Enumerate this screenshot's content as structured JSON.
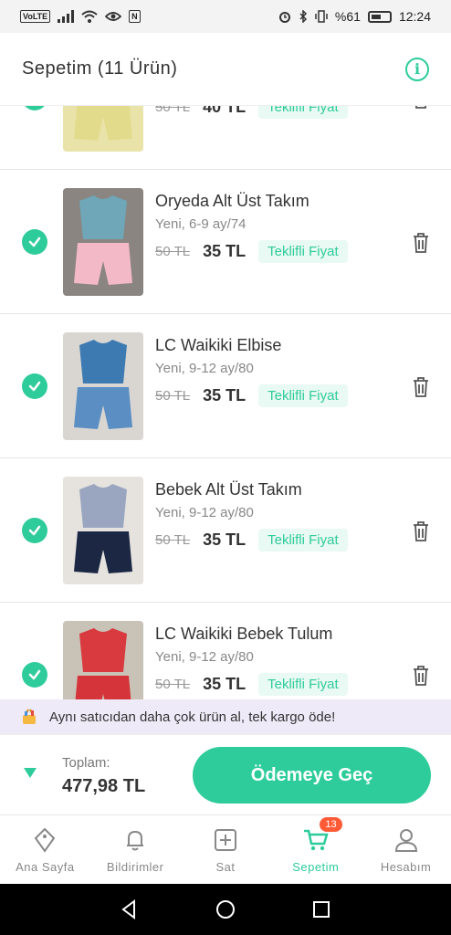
{
  "status_bar": {
    "left_badge": "VoLTE",
    "nfc": "N",
    "battery_pct": "%61",
    "time": "12:24"
  },
  "header": {
    "title": "Sepetim (11 Ürün)",
    "info_icon": "info-icon"
  },
  "items": [
    {
      "title": "",
      "meta": "",
      "old_price": "50 TL",
      "new_price": "40 TL",
      "offer": "Teklifli Fiyat",
      "colors": {
        "bg": "#e9e3a9",
        "top": "#e8e29c",
        "bottom": "#e3db8c"
      }
    },
    {
      "title": "Oryeda Alt Üst Takım",
      "meta": "Yeni, 6-9 ay/74",
      "old_price": "50 TL",
      "new_price": "35 TL",
      "offer": "Teklifli Fiyat",
      "colors": {
        "bg": "#8a8580",
        "top": "#6fa7b8",
        "bottom": "#f3b9c6"
      }
    },
    {
      "title": "LC Waikiki Elbise",
      "meta": "Yeni, 9-12 ay/80",
      "old_price": "50 TL",
      "new_price": "35 TL",
      "offer": "Teklifli Fiyat",
      "colors": {
        "bg": "#d9d6d2",
        "top": "#3d7ab2",
        "bottom": "#5b8fc4"
      }
    },
    {
      "title": "Bebek Alt Üst Takım",
      "meta": "Yeni, 9-12 ay/80",
      "old_price": "50 TL",
      "new_price": "35 TL",
      "offer": "Teklifli Fiyat",
      "colors": {
        "bg": "#e6e3df",
        "top": "#9aa6c0",
        "bottom": "#1b2743"
      }
    },
    {
      "title": "LC Waikiki Bebek Tulum",
      "meta": "Yeni, 9-12 ay/80",
      "old_price": "50 TL",
      "new_price": "35 TL",
      "offer": "Teklifli Fiyat",
      "colors": {
        "bg": "#c9c2b6",
        "top": "#d83a3f",
        "bottom": "#d4343a"
      }
    }
  ],
  "promo": {
    "text": "Aynı satıcıdan daha çok ürün al, tek kargo öde!"
  },
  "checkout": {
    "total_label": "Toplam:",
    "total_value": "477,98 TL",
    "pay_label": "Ödemeye Geç"
  },
  "nav": {
    "home": "Ana Sayfa",
    "notifications": "Bildirimler",
    "sell": "Sat",
    "cart": "Sepetim",
    "cart_badge": "13",
    "account": "Hesabım"
  },
  "colors": {
    "accent": "#2ecc9a",
    "badge": "#ff5a36",
    "promo_bg": "#efeaf8"
  }
}
